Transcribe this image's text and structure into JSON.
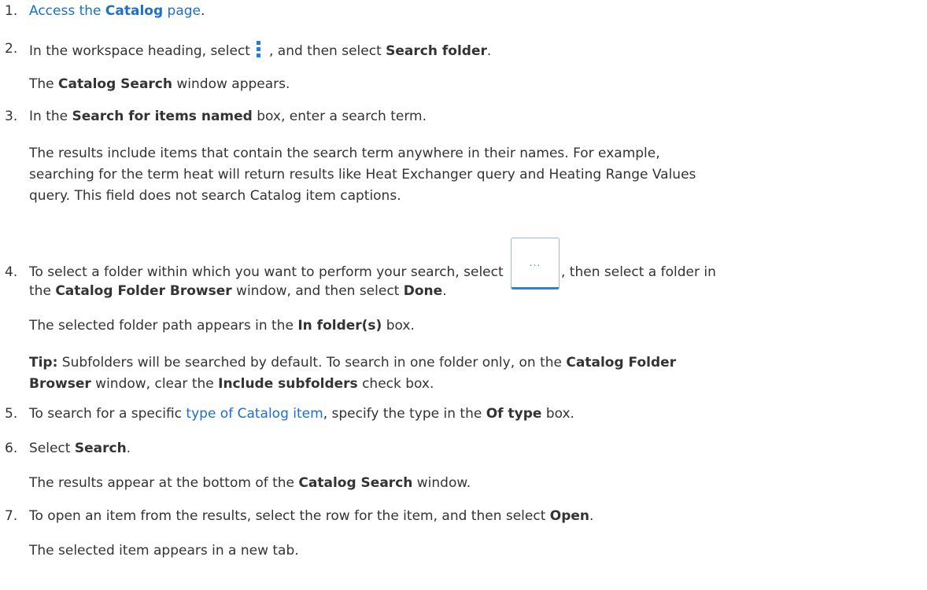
{
  "steps": [
    {
      "num": "1.",
      "pre": "",
      "link_pre": "Access the ",
      "link_bold": "Catalog",
      "link_post": " page",
      "post": "."
    },
    {
      "num": "2.",
      "pre": "In the workspace heading, select",
      "icon": "kebab-menu-icon",
      "mid": ", and then select ",
      "bold": "Search folder",
      "post": ".",
      "note_bold": "Catalog Search",
      "note_post": " window appears.",
      "note_pre": "The "
    },
    {
      "num": "3.",
      "pre": "In the ",
      "bold": "Search for items named",
      "post": " box, enter a search term.",
      "para": [
        "The results include items that contain the search term anywhere in their names. For example,",
        "searching for the term heat will return results like Heat Exchanger query and Heating Range Values",
        "query. This field does not search Catalog item captions."
      ]
    },
    {
      "num": "4.",
      "pre": "To select a folder within which you want to perform your search, select",
      "button_label": "...",
      "mid": ", then select a folder in",
      "line2_pre": "the ",
      "line2_bold": "Catalog Folder Browser",
      "line2_mid": " window, and then select ",
      "line2_bold2": "Done",
      "line2_post": ".",
      "note_pre": "The selected folder path appears in the ",
      "note_bold": "In folder(s)",
      "note_post": " box.",
      "tip_label": "Tip:",
      "tip_pre": " Subfolders will be searched by default. To search in one folder only, on the ",
      "tip_bold1": "Catalog Folder",
      "tip_bold1b": "Browser",
      "tip_mid": " window, clear the ",
      "tip_bold2": "Include subfolders",
      "tip_post": " check box."
    },
    {
      "num": "5.",
      "pre": "To search for a specific ",
      "link": "type of Catalog item",
      "mid": ", specify the type in the ",
      "bold": "Of type",
      "post": " box."
    },
    {
      "num": "6.",
      "pre": "Select ",
      "bold": "Search",
      "post": ".",
      "note_pre": "The results appear at the bottom of the ",
      "note_bold": "Catalog Search",
      "note_post": " window."
    },
    {
      "num": "7.",
      "pre": "To open an item from the results, select the row for the item, and then select ",
      "bold": "Open",
      "post": ".",
      "note": "The selected item appears in a new tab."
    }
  ]
}
